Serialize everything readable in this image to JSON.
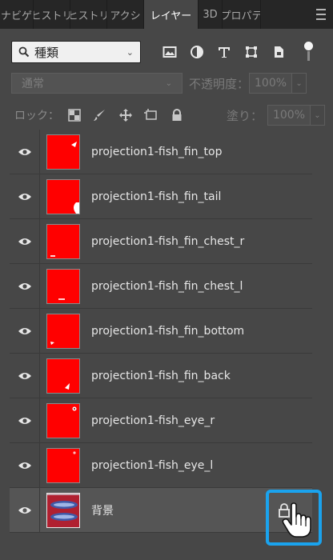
{
  "tabs": [
    {
      "label": "ナビゲ",
      "active": false
    },
    {
      "label": "ヒストリ",
      "active": false
    },
    {
      "label": "ヒストリ",
      "active": false
    },
    {
      "label": "アクシ",
      "active": false
    },
    {
      "label": "レイヤー",
      "active": true
    },
    {
      "label": "3D",
      "active": false
    },
    {
      "label": "プロパテ",
      "active": false
    }
  ],
  "filter": {
    "kind_label": "種類"
  },
  "blend": {
    "mode": "通常",
    "opacity_label": "不透明度：",
    "opacity_value": "100%"
  },
  "lock": {
    "label": "ロック：",
    "fill_label": "塗り：",
    "fill_value": "100%"
  },
  "layers": [
    {
      "name": "projection1-fish_fin_top",
      "visible": true
    },
    {
      "name": "projection1-fish_fin_tail",
      "visible": true
    },
    {
      "name": "projection1-fish_fin_chest_r",
      "visible": true
    },
    {
      "name": "projection1-fish_fin_chest_l",
      "visible": true
    },
    {
      "name": "projection1-fish_fin_bottom",
      "visible": true
    },
    {
      "name": "projection1-fish_fin_back",
      "visible": true
    },
    {
      "name": "projection1-fish_eye_r",
      "visible": true
    },
    {
      "name": "projection1-fish_eye_l",
      "visible": true
    },
    {
      "name": "背景",
      "visible": true,
      "locked": true
    }
  ],
  "colors": {
    "highlight": "#1aa3ee",
    "layer_thumb": "#ff0000",
    "panel": "#474747"
  }
}
